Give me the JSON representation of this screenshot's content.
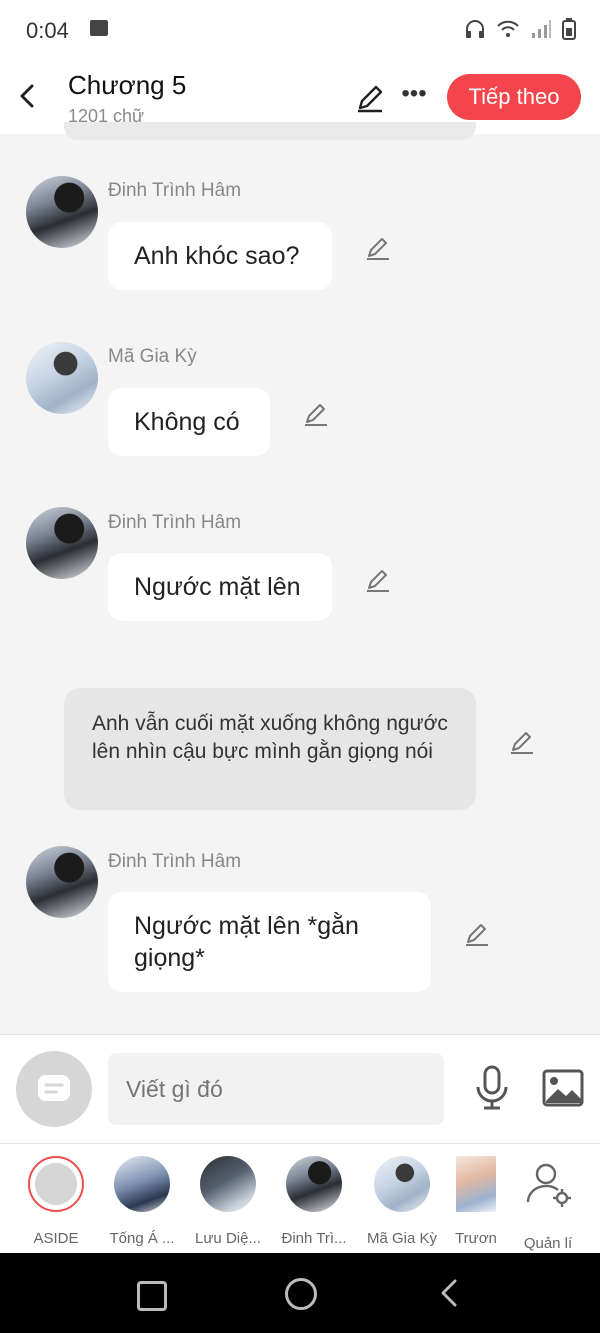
{
  "status_bar": {
    "time": "0:04"
  },
  "header": {
    "title": "Chương 5",
    "subtitle": "1201 chữ",
    "next_button": "Tiếp theo"
  },
  "messages": [
    {
      "sender": "Đinh Trình Hâm",
      "text": "Anh khóc sao?"
    },
    {
      "sender": "Mã Gia Kỳ",
      "text": "Không có"
    },
    {
      "sender": "Đinh Trình Hâm",
      "text": "Ngước mặt lên"
    },
    {
      "narration": "Anh vẫn cuối mặt xuống không ngước lên nhìn cậu bực mình gằn giọng nói"
    },
    {
      "sender": "Đinh Trình Hâm",
      "text": "Ngước mặt lên *gằn giọng*"
    }
  ],
  "composer": {
    "placeholder": "Viết gì đó"
  },
  "characters": [
    {
      "label": "ASIDE"
    },
    {
      "label": "Tống Á ..."
    },
    {
      "label": "Lưu Diệ..."
    },
    {
      "label": "Đinh Trì..."
    },
    {
      "label": "Mã Gia Kỳ"
    },
    {
      "label": "Trươn"
    },
    {
      "label": "Quản lí"
    }
  ],
  "colors": {
    "accent": "#f3454b",
    "background": "#f4f4f4"
  }
}
